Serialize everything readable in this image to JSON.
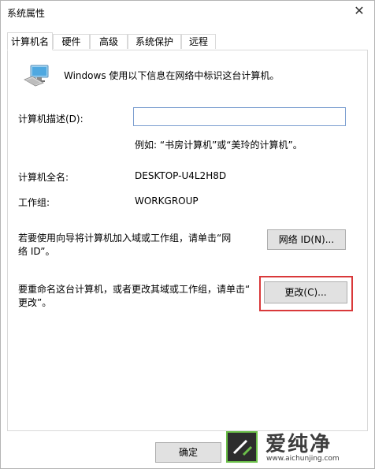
{
  "window": {
    "title": "系统属性",
    "close_glyph": "✕"
  },
  "tabs": [
    {
      "label": "计算机名",
      "active": true
    },
    {
      "label": "硬件",
      "active": false
    },
    {
      "label": "高级",
      "active": false
    },
    {
      "label": "系统保护",
      "active": false
    },
    {
      "label": "远程",
      "active": false
    }
  ],
  "panel": {
    "intro_text": "Windows 使用以下信息在网络中标识这台计算机。",
    "description_label": "计算机描述(D):",
    "description_value": "",
    "description_example": "例如: “书房计算机”或“美玲的计算机”。",
    "fullname_label": "计算机全名:",
    "fullname_value": "DESKTOP-U4L2H8D",
    "workgroup_label": "工作组:",
    "workgroup_value": "WORKGROUP",
    "network_id_text_line1": "若要使用向导将计算机加入域或工作组，请单击“网",
    "network_id_text_line2": "络 ID”。",
    "network_id_button": "网络 ID(N)...",
    "rename_text_line1": "要重命名这台计算机，或者更改其域或工作组，请单击“",
    "rename_text_line2": "更改”。",
    "change_button": "更改(C)..."
  },
  "footer": {
    "ok_button": "确定"
  },
  "watermark": {
    "title": "爱纯净",
    "url": "www.aichunjing.com"
  },
  "colors": {
    "highlight": "#d9393a",
    "input_border": "#7a9dcf",
    "button_bg": "#e1e1e1",
    "watermark_green": "#6cc04a"
  },
  "icons": {
    "computer": "computer-icon",
    "close": "close-icon"
  }
}
